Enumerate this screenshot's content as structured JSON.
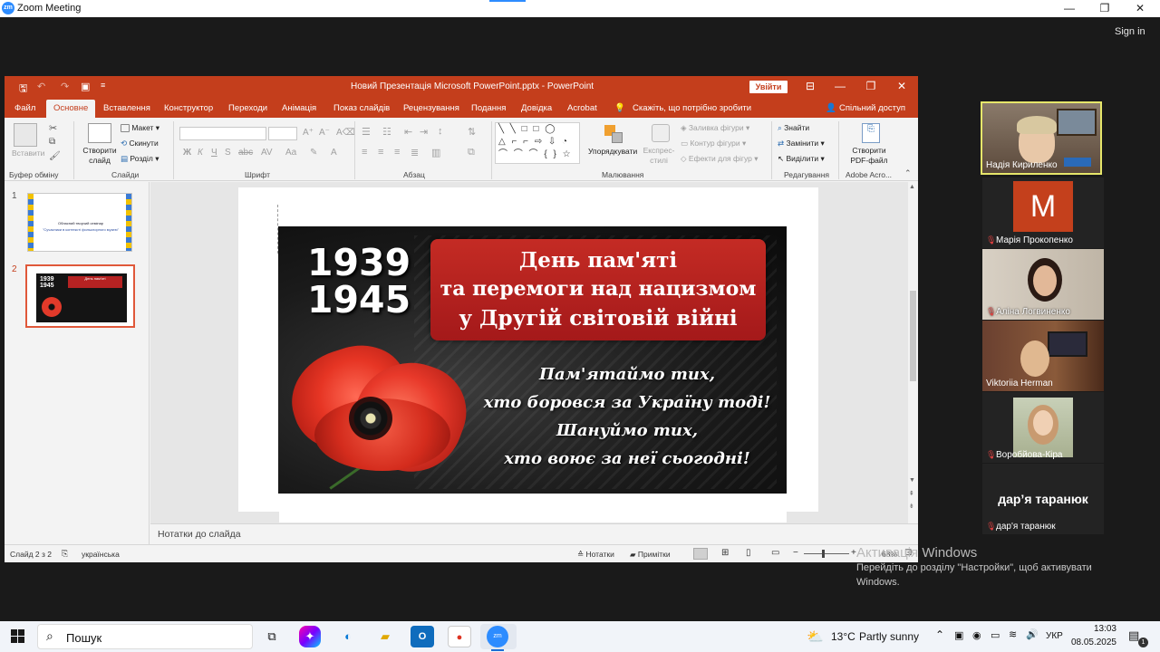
{
  "zoom": {
    "window_title": "Zoom Meeting",
    "logo_text": "zm",
    "sign_in": "Sign in",
    "min": "—",
    "max": "❐",
    "close": "✕"
  },
  "ppt": {
    "doc_title": "Новий Презентація Microsoft PowerPoint.pptx  -  PowerPoint",
    "sign_in_btn": "Увійти",
    "tabs": [
      "Файл",
      "Основне",
      "Вставлення",
      "Конструктор",
      "Переходи",
      "Анімація",
      "Показ слайдів",
      "Рецензування",
      "Подання",
      "Довідка",
      "Acrobat"
    ],
    "tell_me": "Скажіть, що потрібно зробити",
    "share": "Спільний доступ",
    "ribbon": {
      "clipboard": {
        "label": "Буфер обміну",
        "paste": "Вставити"
      },
      "slides": {
        "label": "Слайди",
        "new_slide": "Створити слайд",
        "layout": "Макет",
        "reset": "Скинути",
        "section": "Розділ"
      },
      "font": {
        "label": "Шрифт"
      },
      "paragraph": {
        "label": "Абзац"
      },
      "drawing": {
        "label": "Малювання",
        "arrange": "Упорядкувати",
        "quick_styles": "Експрес-стилі",
        "fill": "Заливка фігури",
        "outline": "Контур фігури",
        "effects": "Ефекти для фігур"
      },
      "editing": {
        "label": "Редагування",
        "find": "Знайти",
        "replace": "Замінити",
        "select": "Виділити"
      },
      "acrobat": {
        "label": "Adobe Acro...",
        "create_pdf": "Створити PDF-файл"
      }
    },
    "thumbs": [
      {
        "num": "1",
        "title": "Обласний творчий семінар",
        "sub": "\"Сучасники в контексті фольклорного музею\""
      },
      {
        "num": "2",
        "title": "1939 1945",
        "sub": "День пам'яті"
      }
    ],
    "slide": {
      "years_top": "1939",
      "years_bottom": "1945",
      "banner_line1": "День пам'яті",
      "banner_line2": "та перемоги над нацизмом",
      "banner_line3": "у Другій світовій війні",
      "verse1": "Пам'ятаймо тих,",
      "verse2": "хто боровся за Україну тоді!",
      "verse3": "Шануймо тих,",
      "verse4": "хто воює за неї сьогодні!"
    },
    "notes_placeholder": "Нотатки до слайда",
    "status": {
      "slide_of": "Слайд 2 з 2",
      "language": "українська",
      "notes_btn": "Нотатки",
      "comments_btn": "Примітки",
      "zoom_pct": "68%"
    }
  },
  "participants": [
    {
      "name": "Надія Кириленко",
      "muted": false,
      "active": true
    },
    {
      "name": "Марія Прокопенко",
      "muted": true,
      "initial": "M"
    },
    {
      "name": "Аліна Логвиненко",
      "muted": true
    },
    {
      "name": "Viktoriia Herman",
      "muted": false
    },
    {
      "name": "Воробйова-Кіра",
      "muted": true
    },
    {
      "name": "дар'я таранюк",
      "muted": true,
      "big": "дар’я таранюк"
    }
  ],
  "activate": {
    "line1": "Активація Windows",
    "line2": "Перейдіть до розділу \"Настройки\", щоб активувати",
    "line3": "Windows."
  },
  "taskbar": {
    "search": "Пошук",
    "weather_temp": "13°C",
    "weather_desc": "Partly sunny",
    "lang": "УКР",
    "time": "13:03",
    "date": "08.05.2025",
    "notif_count": "1"
  },
  "colors": {
    "ppt_accent": "#c43e1c",
    "zoom_blue": "#2d8cff",
    "active_speaker": "#e6e66a"
  }
}
